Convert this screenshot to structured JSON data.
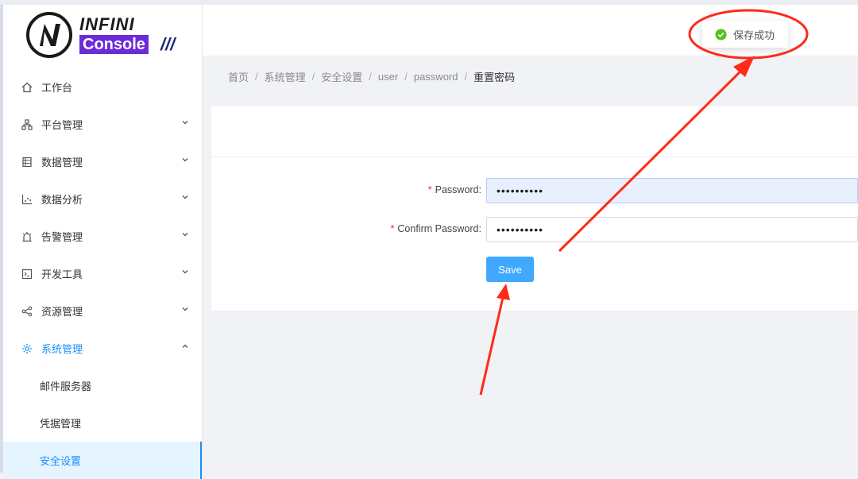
{
  "logo": {
    "line1": "INFINI",
    "line2": "Console",
    "slash": "///"
  },
  "sidebar": {
    "items": [
      {
        "label": "工作台",
        "icon": "home-icon",
        "has_chevron": false
      },
      {
        "label": "平台管理",
        "icon": "cluster-icon",
        "has_chevron": true
      },
      {
        "label": "数据管理",
        "icon": "database-icon",
        "has_chevron": true
      },
      {
        "label": "数据分析",
        "icon": "chart-icon",
        "has_chevron": true
      },
      {
        "label": "告警管理",
        "icon": "alarm-icon",
        "has_chevron": true
      },
      {
        "label": "开发工具",
        "icon": "terminal-icon",
        "has_chevron": true
      },
      {
        "label": "资源管理",
        "icon": "share-icon",
        "has_chevron": true
      },
      {
        "label": "系统管理",
        "icon": "gear-icon",
        "has_chevron": true,
        "expanded": true
      }
    ],
    "subitems": [
      {
        "label": "邮件服务器"
      },
      {
        "label": "凭据管理"
      },
      {
        "label": "安全设置",
        "selected": true
      }
    ]
  },
  "toast": {
    "message": "保存成功",
    "icon": "check-circle-icon",
    "color": "#52c41a"
  },
  "breadcrumb": [
    "首页",
    "系统管理",
    "安全设置",
    "user",
    "password",
    "重置密码"
  ],
  "form": {
    "password_label": "Password",
    "password_value": "••••••••••",
    "confirm_label": "Confirm Password",
    "confirm_value": "••••••••••",
    "required_mark": "*",
    "colon": ":",
    "save_label": "Save"
  },
  "colors": {
    "accent": "#1890ff",
    "button": "#40a9ff",
    "success": "#52c41a",
    "annotation": "#ff2a1a",
    "brand": "#6c2bd9"
  }
}
